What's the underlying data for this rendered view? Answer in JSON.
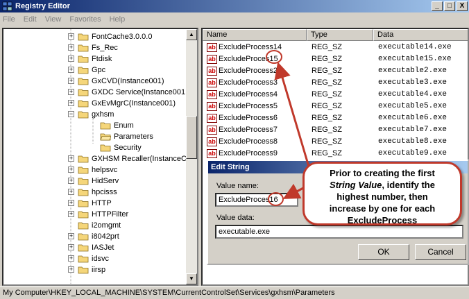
{
  "window": {
    "title": "Registry Editor",
    "controls": {
      "minimize": "_",
      "maximize": "□",
      "close": "X"
    }
  },
  "menu": [
    "File",
    "Edit",
    "View",
    "Favorites",
    "Help"
  ],
  "tree": {
    "items": [
      {
        "label": "FontCache3.0.0.0",
        "expander": "+"
      },
      {
        "label": "Fs_Rec",
        "expander": "+"
      },
      {
        "label": "Ftdisk",
        "expander": "+"
      },
      {
        "label": "Gpc",
        "expander": "+"
      },
      {
        "label": "GxCVD(Instance001)",
        "expander": "+"
      },
      {
        "label": "GXDC Service(Instance001",
        "expander": "+"
      },
      {
        "label": "GxEvMgrC(Instance001)",
        "expander": "+"
      },
      {
        "label": "gxhsm",
        "expander": "−"
      },
      {
        "label": "Enum",
        "expander": ""
      },
      {
        "label": "Parameters",
        "expander": ""
      },
      {
        "label": "Security",
        "expander": ""
      },
      {
        "label": "GXHSM Recaller(InstanceC",
        "expander": "+"
      },
      {
        "label": "helpsvc",
        "expander": "+"
      },
      {
        "label": "HidServ",
        "expander": "+"
      },
      {
        "label": "hpcisss",
        "expander": "+"
      },
      {
        "label": "HTTP",
        "expander": "+"
      },
      {
        "label": "HTTPFilter",
        "expander": "+"
      },
      {
        "label": "i2omgmt",
        "expander": ""
      },
      {
        "label": "i8042prt",
        "expander": "+"
      },
      {
        "label": "IASJet",
        "expander": "+"
      },
      {
        "label": "idsvc",
        "expander": "+"
      },
      {
        "label": "iirsp",
        "expander": "+"
      }
    ]
  },
  "list": {
    "columns": [
      "Name",
      "Type",
      "Data"
    ],
    "rows": [
      {
        "name": "ExcludeProcess14",
        "type": "REG_SZ",
        "data": "executable14.exe"
      },
      {
        "name": "ExcludeProces",
        "type": "REG_SZ",
        "data": "executable15.exe"
      },
      {
        "name": "ExcludeProcess2",
        "type": "REG_SZ",
        "data": "executable2.exe"
      },
      {
        "name": "ExcludeProcess3",
        "type": "REG_SZ",
        "data": "executable3.exe"
      },
      {
        "name": "ExcludeProcess4",
        "type": "REG_SZ",
        "data": "executable4.exe"
      },
      {
        "name": "ExcludeProcess5",
        "type": "REG_SZ",
        "data": "executable5.exe"
      },
      {
        "name": "ExcludeProcess6",
        "type": "REG_SZ",
        "data": "executable6.exe"
      },
      {
        "name": "ExcludeProcess7",
        "type": "REG_SZ",
        "data": "executable7.exe"
      },
      {
        "name": "ExcludeProcess8",
        "type": "REG_SZ",
        "data": "executable8.exe"
      },
      {
        "name": "ExcludeProcess9",
        "type": "REG_SZ",
        "data": "executable9.exe"
      }
    ],
    "highlight_suffix": "15",
    "value_icon": "ab"
  },
  "dialog": {
    "title": "Edit String",
    "value_name_label": "Value name:",
    "value_name": "ExcludeProces",
    "value_name_suffix": "16",
    "value_data_label": "Value data:",
    "value_data": "executable.exe",
    "ok_label": "OK",
    "cancel_label": "Cancel"
  },
  "callout": {
    "line1": "Prior to creating the first",
    "italic": "String Value",
    "line2_rest": ", identify the",
    "line3": "highest number, then",
    "line4": "increase by one for each",
    "line5": "ExcludeProcess"
  },
  "status": {
    "path": "My Computer\\HKEY_LOCAL_MACHINE\\SYSTEM\\CurrentControlSet\\Services\\gxhsm\\Parameters"
  },
  "colors": {
    "title_start": "#0a246a",
    "title_end": "#a6caf0",
    "annotation_red": "#c0392b",
    "folder_yellow": "#f5d67a"
  }
}
